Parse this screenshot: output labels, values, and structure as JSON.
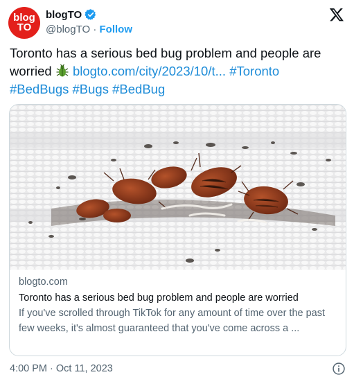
{
  "profile": {
    "avatar_line1": "blog",
    "avatar_line2": "TO",
    "name": "blogTO",
    "handle": "@blogTO",
    "separator": " · ",
    "follow_label": "Follow"
  },
  "tweet": {
    "text_before": "Toronto has a serious bed bug problem and people are worried ",
    "link": "blogto.com/city/2023/10/t...",
    "hashtags": [
      "#Toronto",
      "#BedBugs",
      "#Bugs",
      "#BedBug"
    ]
  },
  "card": {
    "domain": "blogto.com",
    "title": "Toronto has a serious bed bug problem and people are worried",
    "description": "If you've scrolled through TikTok for any amount of time over the past few weeks, it's almost guaranteed that you've come across a ..."
  },
  "timestamp": "4:00 PM · Oct 11, 2023",
  "colors": {
    "accent": "#1d9bf0",
    "avatar_red": "#e3201b",
    "muted": "#536471"
  },
  "icons": [
    "verified-badge-icon",
    "x-logo-icon",
    "bug-emoji-icon",
    "info-icon"
  ]
}
